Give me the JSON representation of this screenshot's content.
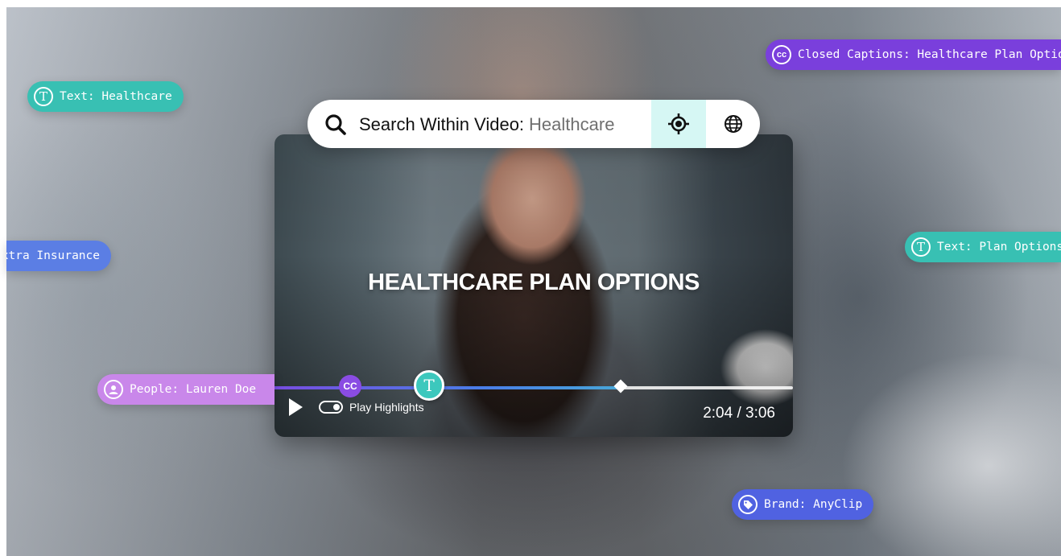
{
  "search": {
    "label": "Search Within Video:",
    "value": "Healthcare",
    "icons": [
      "search-icon",
      "locate-icon",
      "globe-icon"
    ]
  },
  "video": {
    "title_overlay": "HEALTHCARE PLAN OPTIONS",
    "play_highlights_label": "Play Highlights",
    "time_current": "2:04",
    "time_separator": "/",
    "time_total": "3:06",
    "progress_fraction": 0.667,
    "marker_cc_label": "CC",
    "marker_text_label": "T"
  },
  "tags": {
    "text_healthcare": "Text: Healthcare",
    "closed_captions": "Closed Captions: Healthcare Plan Options",
    "insurance": "Extra Insurance",
    "text_plan_options": "Text: Plan Options",
    "people": "People: Lauren Doe",
    "brand": "Brand: AnyClip",
    "icon_text": "T",
    "icon_cc": "cc"
  },
  "colors": {
    "text_tag": "#38c0b3",
    "cc_tag": "#7a3fdc",
    "insurance_tag": "#5b7ee4",
    "people_tag": "#c987ea",
    "brand_tag": "#5062e1",
    "locate_button_bg": "#d6f7f4"
  }
}
